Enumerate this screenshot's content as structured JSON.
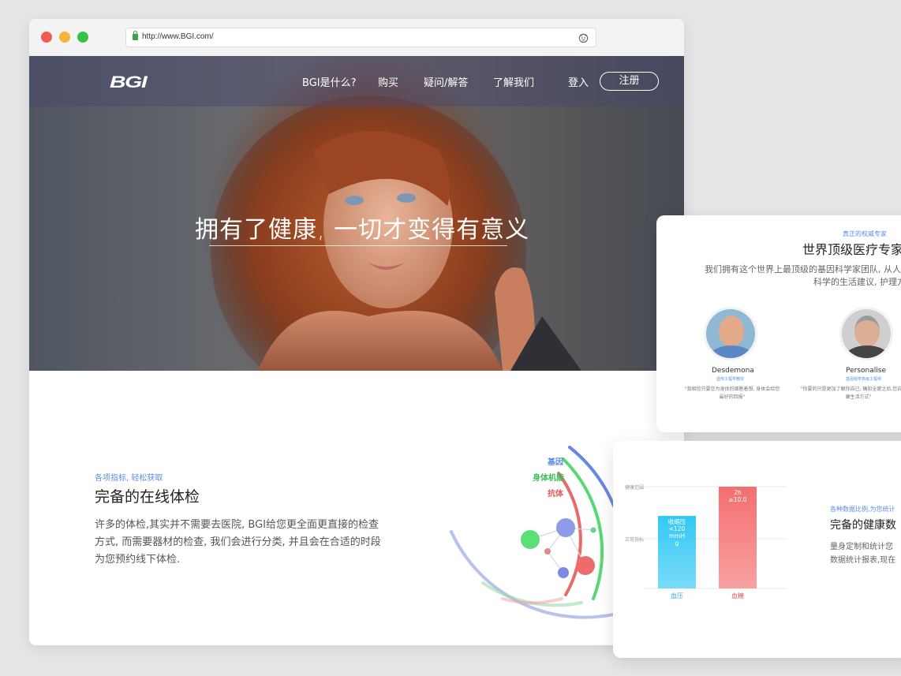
{
  "browser": {
    "url": "http://www.BGI.com/"
  },
  "nav": {
    "logo": "BGI",
    "items": [
      "BGI是什么?",
      "购买",
      "疑问/解答",
      "了解我们"
    ],
    "login": "登入",
    "signup": "注册"
  },
  "hero": {
    "title": "拥有了健康, 一切才变得有意义"
  },
  "section": {
    "tag": "各项指标, 轻松获取",
    "title": "完备的在线体检",
    "desc": "许多的体检,其实并不需要去医院, BGI给您更全面更直接的检查方式, 而需要器材的检查, 我们会进行分类, 并且会在合适的时段为您预约线下体检."
  },
  "rings": {
    "labels": [
      "基因",
      "身体机能",
      "抗体"
    ],
    "colors": [
      "#6b86e0",
      "#58d872",
      "#e86a6a"
    ]
  },
  "experts_card": {
    "tag": "真正的权威专家",
    "title": "世界顶级医疗专家",
    "desc1": "我们拥有这个世界上最顶级的基因科学家团队, 从人",
    "desc2": "科学的生活建议, 护理方",
    "people": [
      {
        "name": "Desdemona",
        "role": "遗传工程学教授",
        "quote": "\"我相信只要您为身体的细胞着想, 身体会给您最好的回报\""
      },
      {
        "name": "Personalise",
        "role": "基因组学高级工程师",
        "quote": "\"你要的只是更加了解你自己, 确知全貌之后,您自己的健康生活方式\""
      }
    ]
  },
  "health_card": {
    "tag": "各种数据比例,为您统计",
    "title": "完备的健康数",
    "desc": [
      "量身定制和统计您",
      "数据统计报表,现在"
    ]
  },
  "chart_data": {
    "type": "bar",
    "categories": [
      "血压",
      "血糖"
    ],
    "bar_labels": [
      "收缩压\n<120\nmmH\ng",
      "2h\n≥10.0"
    ],
    "reference_lines": [
      "健康范围",
      "正常指标"
    ],
    "colors": [
      "#33c8f5",
      "#f46f6f"
    ]
  }
}
